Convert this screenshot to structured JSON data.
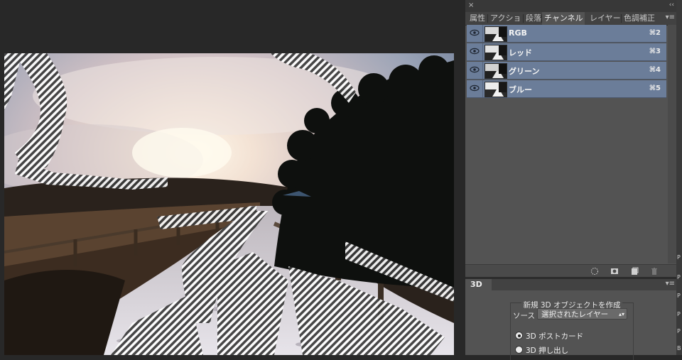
{
  "panel": {
    "close_glyph": "×",
    "collapse_glyph": "‹‹",
    "tabs": [
      {
        "label": "属性",
        "active": false
      },
      {
        "label": "アクショ",
        "active": false
      },
      {
        "label": "段落",
        "active": false
      },
      {
        "label": "チャンネル",
        "active": true
      },
      {
        "label": "レイヤー",
        "active": false
      },
      {
        "label": "色調補正",
        "active": false
      }
    ],
    "tab_menu_glyph": "▾≡",
    "channels": [
      {
        "name": "RGB",
        "shortcut": "⌘2"
      },
      {
        "name": "レッド",
        "shortcut": "⌘3"
      },
      {
        "name": "グリーン",
        "shortcut": "⌘4"
      },
      {
        "name": "ブルー",
        "shortcut": "⌘5"
      }
    ],
    "footer_icons": [
      "load-selection-icon",
      "save-mask-icon",
      "new-channel-icon",
      "trash-icon"
    ]
  },
  "three_d": {
    "tab_label": "3D",
    "menu_glyph": "▾≡",
    "group_title": "新規 3D オブジェクトを作成",
    "source_label": "ソース :",
    "source_value": "選択されたレイヤー",
    "options": [
      {
        "label": "3D ポストカード",
        "selected": true
      },
      {
        "label": "3D 押し出し",
        "selected": false
      }
    ]
  },
  "right_strip": {
    "chars": [
      "P",
      "P",
      "P",
      "P",
      "P",
      "B"
    ]
  },
  "colors": {
    "channel_row": "#6b7d99",
    "panel_bg": "#535353",
    "app_bg": "#282828"
  }
}
